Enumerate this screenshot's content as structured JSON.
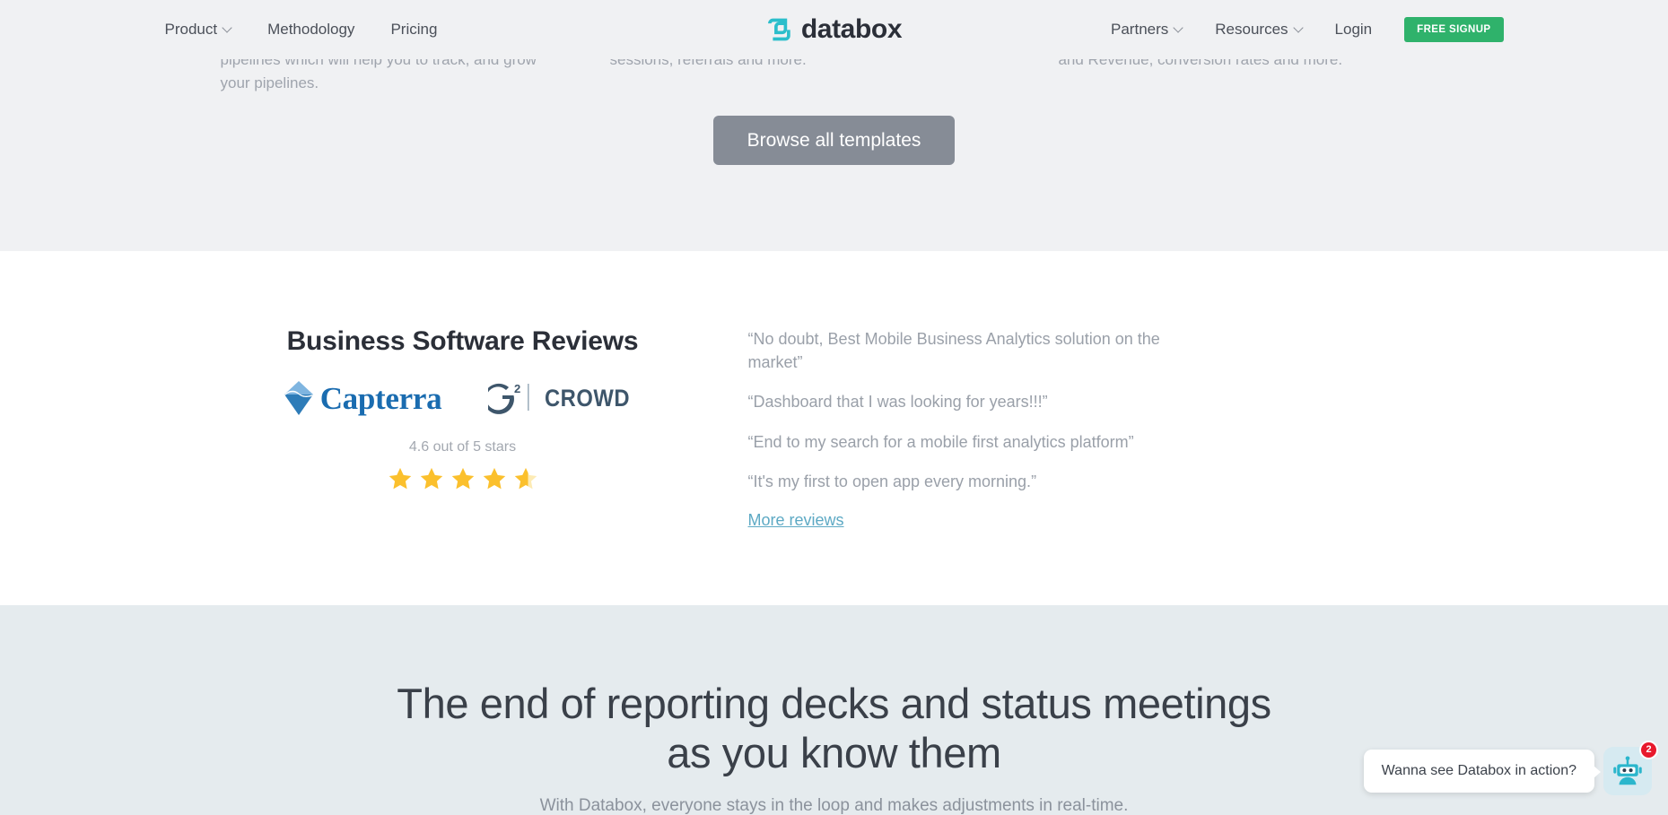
{
  "header": {
    "nav_left": [
      {
        "label": "Product",
        "has_caret": true,
        "icon": "chevron-down-icon"
      },
      {
        "label": "Methodology",
        "has_caret": false
      },
      {
        "label": "Pricing",
        "has_caret": false
      }
    ],
    "logo": {
      "text": "databox",
      "icon": "databox-logo-icon",
      "color": "#2bbecb"
    },
    "nav_right": [
      {
        "label": "Partners",
        "has_caret": true,
        "icon": "chevron-down-icon"
      },
      {
        "label": "Resources",
        "has_caret": true,
        "icon": "chevron-down-icon"
      },
      {
        "label": "Login",
        "has_caret": false
      }
    ],
    "signup_label": "FREE SIGNUP",
    "signup_color": "#2fb26b",
    "background": "#f0f1f3"
  },
  "templates_section": {
    "background": "#f0f1f3",
    "columns": [
      {
        "text": "pipelines which will help you to track, and grow your pipelines."
      },
      {
        "text": "sessions, referrals and more."
      },
      {
        "text": "and Revenue, conversion rates and more."
      }
    ],
    "browse_button": {
      "label": "Browse all templates",
      "color": "#868c96"
    }
  },
  "reviews_section": {
    "background": "#ffffff",
    "title": "Business Software Reviews",
    "badges": [
      {
        "name": "capterra-logo",
        "text": "Capterra",
        "color": "#1a6cb0"
      },
      {
        "name": "g2crowd-logo",
        "text": "CROWD",
        "mark": "G",
        "superscript": "2",
        "color": "#3e566b"
      }
    ],
    "rating_text": "4.6 out of 5 stars",
    "rating_value": 4.6,
    "rating_max": 5,
    "star_color": "#fbc02d",
    "quotes": [
      "“No doubt, Best Mobile Business Analytics solution on the market”",
      "“Dashboard that I was looking for years!!!”",
      "“End to my search for a mobile first analytics platform”",
      "“It's my first to open app every morning.”"
    ],
    "more_link": {
      "label": "More reviews",
      "color": "#5da9c4"
    }
  },
  "cta_section": {
    "background": "#e5ebee",
    "title_line1": "The end of reporting decks and status meetings",
    "title_line2": "as you know them",
    "subtitle": "With Databox, everyone stays in the loop and makes adjustments in real-time."
  },
  "chat_widget": {
    "message": "Wanna see Databox in action?",
    "badge_count": "2",
    "badge_color": "#e8192c",
    "launcher_icon": "robot-chat-icon",
    "launcher_color": "#2bbecb"
  }
}
